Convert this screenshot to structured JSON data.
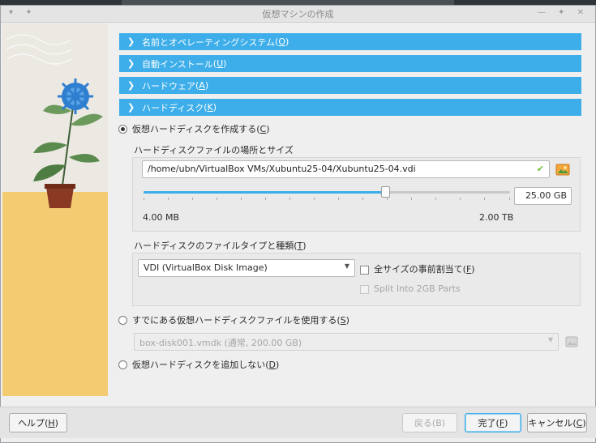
{
  "window": {
    "title": "仮想マシンの作成"
  },
  "sections": [
    {
      "label": "名前とオペレーティングシステム",
      "key": "O"
    },
    {
      "label": "自動インストール",
      "key": "U"
    },
    {
      "label": "ハードウェア",
      "key": "A"
    },
    {
      "label": "ハードディスク",
      "key": "K"
    }
  ],
  "harddisk": {
    "create_option": {
      "label": "仮想ハードディスクを作成する",
      "key": "C",
      "selected": true
    },
    "location_group_label": "ハードディスクファイルの場所とサイズ",
    "path_value": "/home/ubn/VirtualBox VMs/Xubuntu25-04/Xubuntu25-04.vdi",
    "size_value": "25.00 GB",
    "slider_fraction": 0.66,
    "size_min_label": "4.00 MB",
    "size_max_label": "2.00 TB",
    "type_group_label": "ハードディスクのファイルタイプと種類",
    "type_group_key": "T",
    "file_type_selected": "VDI (VirtualBox Disk Image)",
    "preallocate_label": "全サイズの事前割当て",
    "preallocate_key": "F",
    "split_label": "Split Into 2GB Parts",
    "existing_option": {
      "label": "すでにある仮想ハードディスクファイルを使用する",
      "key": "S",
      "selected": false
    },
    "existing_file_value": "box-disk001.vmdk (通常, 200.00 GB)",
    "none_option": {
      "label": "仮想ハードディスクを追加しない",
      "key": "D",
      "selected": false
    }
  },
  "buttons": {
    "help": {
      "label": "ヘルプ",
      "key": "H"
    },
    "back": {
      "label": "戻る(B)"
    },
    "finish": {
      "label": "完了",
      "key": "F"
    },
    "cancel": {
      "label": "キャンセル",
      "key": "C"
    }
  },
  "colors": {
    "accent": "#3daee9",
    "check_ok": "#6cbf3a"
  }
}
